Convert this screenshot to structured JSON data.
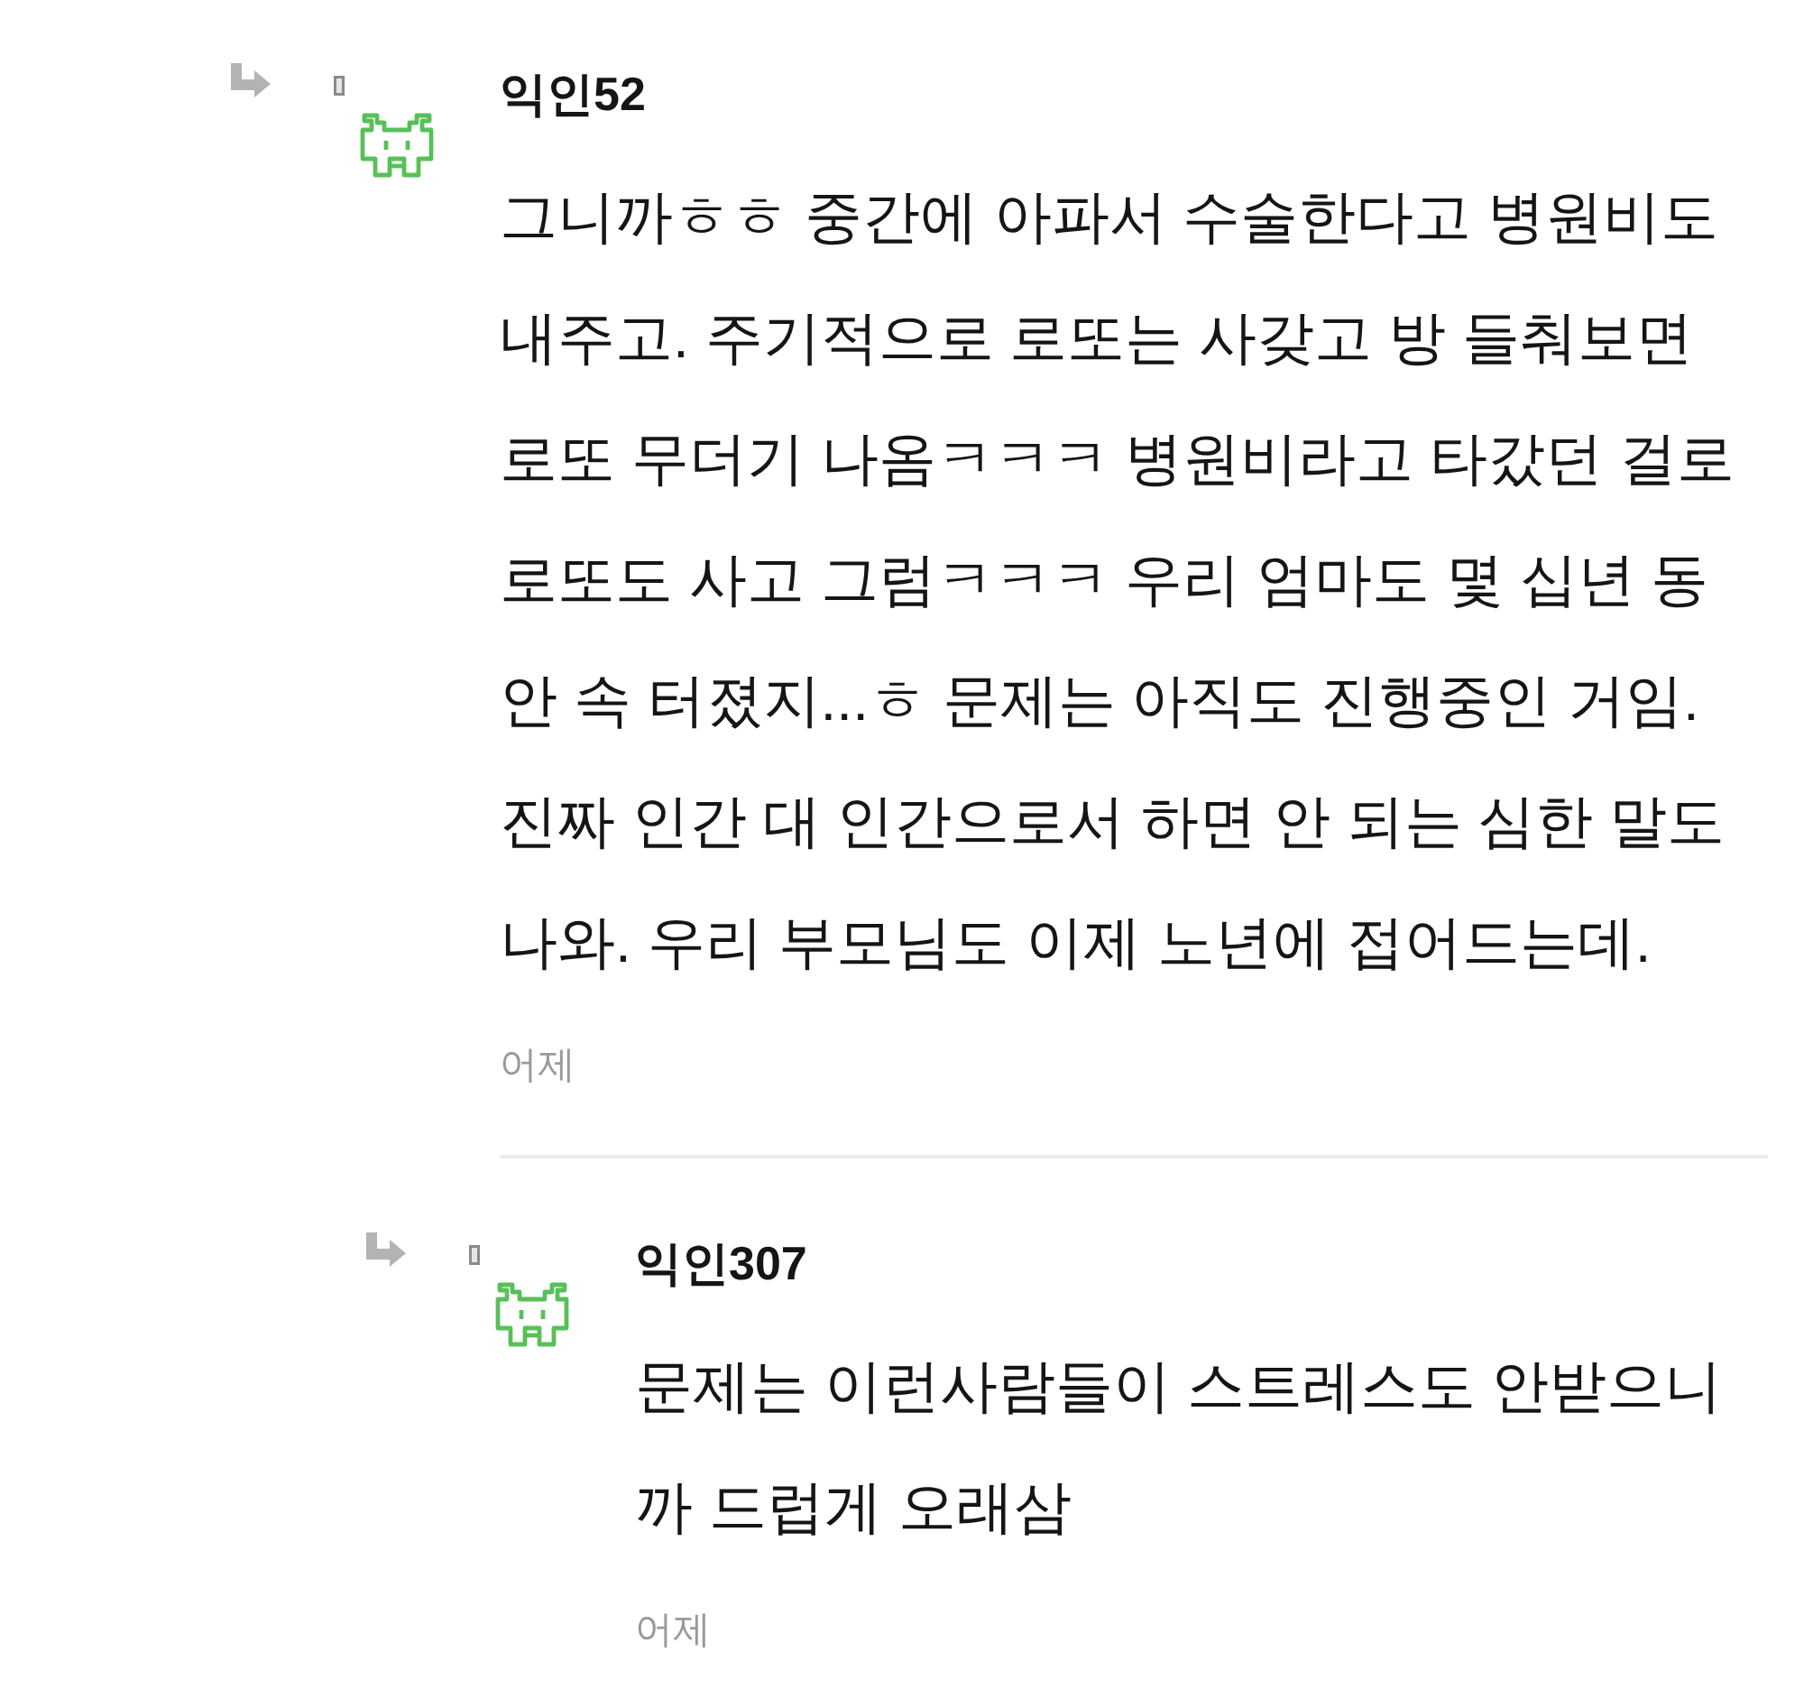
{
  "comments": [
    {
      "reply": true,
      "author": "익인52",
      "body_lines": [
        "그니까ㅎㅎ 중간에 아파서 수술한다고 병원비도",
        "내주고. 주기적으로 로또는 사갖고 방 들춰보면",
        "로또 무더기 나옴ㅋㅋㅋ 병원비라고 타갔던 걸로",
        "로또도 사고 그럼ㅋㅋㅋ 우리 엄마도 몇 십년 동",
        "안 속 터졌지...ㅎ 문제는 아직도 진행중인 거임.",
        "진짜 인간 대 인간으로서 하면 안 되는 심한 말도",
        "나와. 우리 부모님도 이제 노년에 접어드는데."
      ],
      "time": "어제",
      "children": [
        {
          "reply": true,
          "author": "익인307",
          "body_lines": [
            "문제는 이런사람들이 스트레스도 안받으니",
            "까 드럽게 오래삼"
          ],
          "time": "어제"
        }
      ]
    }
  ]
}
